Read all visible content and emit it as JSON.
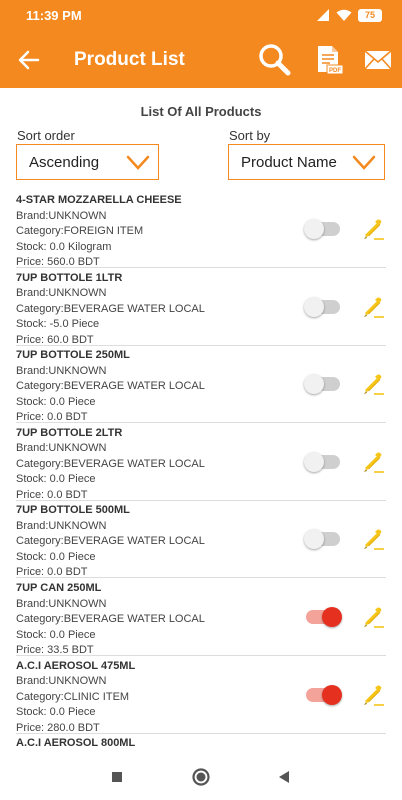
{
  "status": {
    "time": "11:39 PM",
    "battery": "75"
  },
  "appbar": {
    "title": "Product List",
    "icons": [
      "back-arrow-icon",
      "search-icon",
      "pdf-icon",
      "mail-icon"
    ]
  },
  "list_title": "List Of All Products",
  "sort_order": {
    "label": "Sort order",
    "value": "Ascending"
  },
  "sort_by": {
    "label": "Sort by",
    "value": "Product Name"
  },
  "colors": {
    "accent": "#f4891f",
    "toggle_on": "#e53020",
    "edit": "#f5c518"
  },
  "products": [
    {
      "name": "4-STAR MOZZARELLA CHEESE",
      "brand": "Brand:UNKNOWN",
      "category": "Category:FOREIGN ITEM",
      "stock": "Stock: 0.0 Kilogram",
      "price": "Price: 560.0 BDT",
      "enabled": false
    },
    {
      "name": "7UP BOTTOLE 1LTR",
      "brand": "Brand:UNKNOWN",
      "category": "Category:BEVERAGE WATER LOCAL",
      "stock": "Stock: -5.0 Piece",
      "price": "Price: 60.0 BDT",
      "enabled": false
    },
    {
      "name": "7UP BOTTOLE 250ML",
      "brand": "Brand:UNKNOWN",
      "category": "Category:BEVERAGE WATER LOCAL",
      "stock": "Stock: 0.0 Piece",
      "price": "Price: 0.0 BDT",
      "enabled": false
    },
    {
      "name": "7UP BOTTOLE 2LTR",
      "brand": "Brand:UNKNOWN",
      "category": "Category:BEVERAGE WATER LOCAL",
      "stock": "Stock: 0.0 Piece",
      "price": "Price: 0.0 BDT",
      "enabled": false
    },
    {
      "name": "7UP BOTTOLE 500ML",
      "brand": "Brand:UNKNOWN",
      "category": "Category:BEVERAGE WATER LOCAL",
      "stock": "Stock: 0.0 Piece",
      "price": "Price: 0.0 BDT",
      "enabled": false
    },
    {
      "name": "7UP CAN 250ML",
      "brand": "Brand:UNKNOWN",
      "category": "Category:BEVERAGE WATER LOCAL",
      "stock": "Stock: 0.0 Piece",
      "price": "Price: 33.5 BDT",
      "enabled": true
    },
    {
      "name": "A.C.I AEROSOL 475ML",
      "brand": "Brand:UNKNOWN",
      "category": "Category:CLINIC ITEM",
      "stock": "Stock: 0.0 Piece",
      "price": "Price: 280.0 BDT",
      "enabled": true
    },
    {
      "name": "A.C.I AEROSOL 800ML"
    }
  ]
}
